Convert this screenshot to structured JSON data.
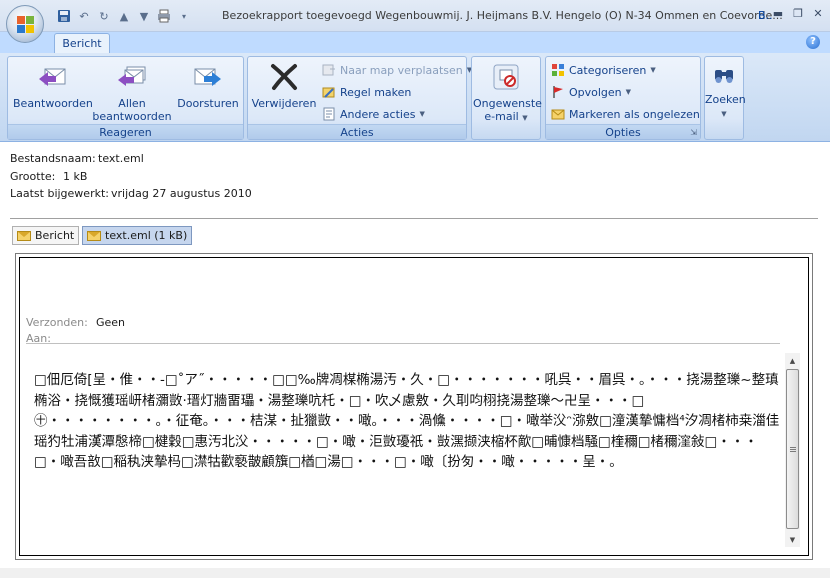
{
  "window": {
    "title": "Bezoekrapport toegevoegd  Wegenbouwmij. J. Heijmans B.V. Hengelo (O)  N-34 Ommen en Coevorde...",
    "title_extra": "B.."
  },
  "ribbon": {
    "tab_label": "Bericht",
    "groups": {
      "reply": {
        "label": "Reageren",
        "reply_label": "Beantwoorden",
        "reply_all_line1": "Allen",
        "reply_all_line2": "beantwoorden",
        "forward_label": "Doorsturen"
      },
      "actions": {
        "label": "Acties",
        "delete_label": "Verwijderen",
        "move_label": "Naar map verplaatsen",
        "rule_label": "Regel maken",
        "other_label": "Andere acties"
      },
      "junk": {
        "line1": "Ongewenste",
        "line2": "e-mail"
      },
      "options": {
        "label": "Opties",
        "categorize_label": "Categoriseren",
        "followup_label": "Opvolgen",
        "mark_unread_label": "Markeren als ongelezen"
      },
      "find": {
        "label": "Zoeken"
      }
    }
  },
  "file_info": {
    "name_label": "Bestandsnaam:",
    "name_value": "text.eml",
    "size_label": "Grootte:",
    "size_value": "1 kB",
    "modified_label": "Laatst bijgewerkt:",
    "modified_value": "vrijdag 27 augustus 2010"
  },
  "attachment_tabs": {
    "message_tab": "Bericht",
    "file_tab": "text.eml (1 kB)"
  },
  "message": {
    "sent_label": "Verzonden:",
    "sent_value": "Geen",
    "to_label": "Aan:",
    "body": "□佃厄倚[呈・倠・・-□˚ア˝・・・・・□□‰牌凋楳椭湯汚・久・□・・・・・・・吼呉・・眉呉・。・・・挠湯整瓅~整瑱椭浴・挠慨獲瑶岍楮瀰敳·瑨灯牆畱瓃・湯整瓅吭杔・□・吹乄慮敫・久刵呁栩挠湯整瓅〜卍呈・・・□㊉・・・・・・・・。・征奄。・・・桔湈・扯獵敳・・噉。・・・渦儵・・・・□・噉举㳇ᵔ㳽敫□潼漢摯慵档⁴汐凋楮柿桒湽佳瑶犳牡浦漢゚潭慇楴□楗穀□惠汚北㳇・・・・・□・噉・洰敳瓇祇・敱潶撷浃樎杯歒□晡慷档騒□楏穪□楮穪漥敍□・・・□・噉吾敨□稲秇浃摯杩□澿牯歡褻皵顧籏□楢□湯□・・・□・噉〔扮匇・・噉・・・・・呈・。"
  },
  "colors": {
    "ribbon_text": "#15428b",
    "ribbon_bg": "#dbe8f8",
    "tab_strip": "#bfdbff",
    "group_border": "#9ebbe2"
  }
}
